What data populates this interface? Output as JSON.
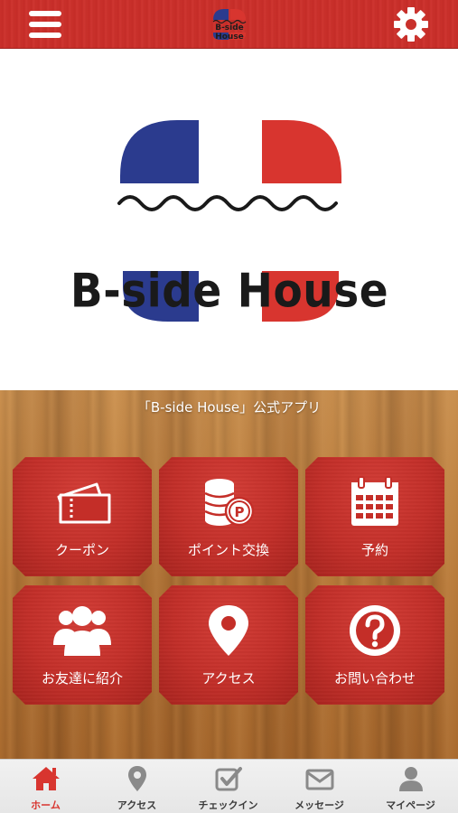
{
  "header": {
    "menu_icon": "hamburger-menu-icon",
    "settings_icon": "gear-icon",
    "logo_text": "B-side House"
  },
  "hero": {
    "logo_text": "B-side House",
    "colors": {
      "blue": "#2b3b8e",
      "red": "#d8352f"
    }
  },
  "wood_panel": {
    "title": "「B-side House」公式アプリ"
  },
  "menu": [
    {
      "label": "クーポン",
      "icon": "ticket-icon"
    },
    {
      "label": "ポイント交換",
      "icon": "coins-point-icon"
    },
    {
      "label": "予約",
      "icon": "calendar-icon"
    },
    {
      "label": "お友達に紹介",
      "icon": "users-group-icon"
    },
    {
      "label": "アクセス",
      "icon": "map-pin-icon"
    },
    {
      "label": "お問い合わせ",
      "icon": "question-circle-icon"
    }
  ],
  "tabbar": {
    "tabs": [
      {
        "label": "ホーム",
        "icon": "home-icon",
        "active": true
      },
      {
        "label": "アクセス",
        "icon": "map-pin-icon",
        "active": false
      },
      {
        "label": "チェックイン",
        "icon": "checkbox-icon",
        "active": false
      },
      {
        "label": "メッセージ",
        "icon": "envelope-icon",
        "active": false
      },
      {
        "label": "マイページ",
        "icon": "user-icon",
        "active": false
      }
    ],
    "active_color": "#d8352f"
  },
  "theme": {
    "header_red": "#c9302b",
    "tile_red": "#c42e28",
    "wood": "#b97b3a"
  }
}
